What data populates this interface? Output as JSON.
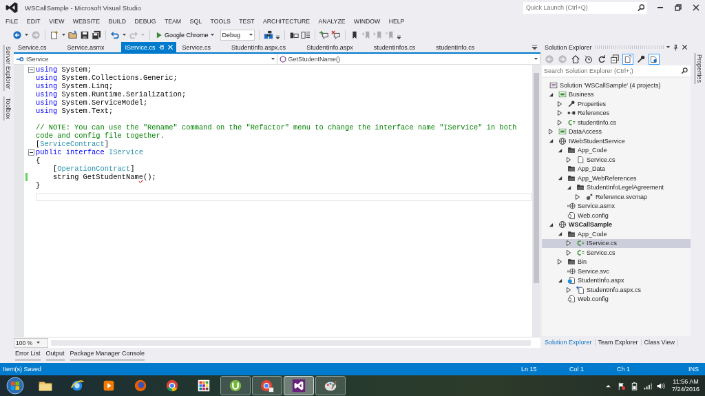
{
  "window": {
    "title": "WSCallSample - Microsoft Visual Studio",
    "quick_launch": {
      "placeholder": "Quick Launch (Ctrl+Q)"
    }
  },
  "menu": [
    "FILE",
    "EDIT",
    "VIEW",
    "WEBSITE",
    "BUILD",
    "DEBUG",
    "TEAM",
    "SQL",
    "TOOLS",
    "TEST",
    "ARCHITECTURE",
    "ANALYZE",
    "WINDOW",
    "HELP"
  ],
  "toolbar": [
    {
      "kind": "back",
      "disabled": false
    },
    {
      "kind": "caret",
      "disabled": false
    },
    {
      "kind": "forward",
      "disabled": true
    },
    {
      "kind": "separator"
    },
    {
      "kind": "new",
      "disabled": false
    },
    {
      "kind": "caret",
      "disabled": false
    },
    {
      "kind": "open",
      "disabled": false
    },
    {
      "kind": "save",
      "disabled": false
    },
    {
      "kind": "saveall",
      "disabled": false
    },
    {
      "kind": "separator"
    },
    {
      "kind": "undo",
      "disabled": false
    },
    {
      "kind": "caret",
      "disabled": false
    },
    {
      "kind": "redo",
      "disabled": true
    },
    {
      "kind": "caret",
      "disabled": true
    },
    {
      "kind": "separator"
    },
    {
      "kind": "run",
      "label": "Google Chrome"
    },
    {
      "kind": "dropdown",
      "value": "Debug"
    },
    {
      "kind": "separator"
    },
    {
      "kind": "find",
      "disabled": false
    },
    {
      "kind": "overflow"
    },
    {
      "kind": "separator"
    },
    {
      "kind": "outdent",
      "disabled": false
    },
    {
      "kind": "indent",
      "disabled": false
    },
    {
      "kind": "separator"
    },
    {
      "kind": "comment",
      "disabled": false
    },
    {
      "kind": "uncomment",
      "disabled": false
    },
    {
      "kind": "separator"
    },
    {
      "kind": "bookmark",
      "disabled": false
    },
    {
      "kind": "bmprev",
      "disabled": true
    },
    {
      "kind": "bmnext",
      "disabled": true
    },
    {
      "kind": "bmclear",
      "disabled": true
    },
    {
      "kind": "overflow"
    }
  ],
  "left_side_tabs": [
    "Server Explorer",
    "Toolbox"
  ],
  "editor": {
    "tabs": [
      {
        "label": "Service.cs",
        "selected": false
      },
      {
        "label": "Service.asmx",
        "selected": false
      },
      {
        "label": "IService.cs",
        "selected": true
      },
      {
        "label": "Service.cs",
        "selected": false
      },
      {
        "label": "StudentInfo.aspx.cs",
        "selected": false
      },
      {
        "label": "StudentInfo.aspx",
        "selected": false
      },
      {
        "label": "studentInfos.cs",
        "selected": false
      },
      {
        "label": "studentInfo.cs",
        "selected": false
      }
    ],
    "type_dropdown": "IService",
    "member_dropdown": "GetStudentName()",
    "lines": [
      {
        "tokens": [
          {
            "kind": "keyword",
            "text": "using"
          },
          {
            "kind": "plain",
            "text": " System;"
          }
        ],
        "fold": true,
        "changed": false,
        "current": false
      },
      {
        "tokens": [
          {
            "kind": "keyword",
            "text": "using"
          },
          {
            "kind": "plain",
            "text": " System.Collections.Generic;"
          }
        ],
        "fold": false,
        "changed": false,
        "current": false
      },
      {
        "tokens": [
          {
            "kind": "keyword",
            "text": "using"
          },
          {
            "kind": "plain",
            "text": " System.Linq;"
          }
        ],
        "fold": false,
        "changed": false,
        "current": false
      },
      {
        "tokens": [
          {
            "kind": "keyword",
            "text": "using"
          },
          {
            "kind": "plain",
            "text": " System.Runtime.Serialization;"
          }
        ],
        "fold": false,
        "changed": false,
        "current": false
      },
      {
        "tokens": [
          {
            "kind": "keyword",
            "text": "using"
          },
          {
            "kind": "plain",
            "text": " System.ServiceModel;"
          }
        ],
        "fold": false,
        "changed": false,
        "current": false
      },
      {
        "tokens": [
          {
            "kind": "keyword",
            "text": "using"
          },
          {
            "kind": "plain",
            "text": " System.Text;"
          }
        ],
        "fold": false,
        "changed": false,
        "current": false
      },
      {
        "fold": false,
        "changed": false,
        "current": false
      },
      {
        "tokens": [
          {
            "kind": "comment",
            "text": "// NOTE: You can use the \"Rename\" command on the \"Refactor\" menu to change the interface name \"IService\" in both code and config file together."
          }
        ],
        "fold": false,
        "changed": false,
        "current": false
      },
      {
        "tokens": [
          {
            "kind": "plain",
            "text": "["
          },
          {
            "kind": "type",
            "text": "ServiceContract"
          },
          {
            "kind": "plain",
            "text": "]"
          }
        ],
        "fold": false,
        "changed": false,
        "current": false
      },
      {
        "tokens": [
          {
            "kind": "keyword",
            "text": "public interface"
          },
          {
            "kind": "type",
            "text": " IService"
          }
        ],
        "fold": true,
        "changed": false,
        "current": false
      },
      {
        "tokens": [
          {
            "kind": "plain",
            "text": "{"
          }
        ],
        "fold": false,
        "changed": false,
        "current": false
      },
      {
        "tokens": [
          {
            "kind": "plain",
            "text": "    ["
          },
          {
            "kind": "type",
            "text": "OperationContract"
          },
          {
            "kind": "plain",
            "text": "]"
          }
        ],
        "fold": false,
        "changed": false,
        "current": false
      },
      {
        "tokens": [
          {
            "kind": "plain",
            "text": "    string GetStudentNam"
          },
          {
            "kind": "error",
            "text": "e"
          },
          {
            "kind": "plain",
            "text": "();"
          }
        ],
        "fold": false,
        "changed": true,
        "current": false
      },
      {
        "tokens": [
          {
            "kind": "plain",
            "text": "}"
          }
        ],
        "fold": false,
        "changed": false,
        "current": false
      },
      {
        "fold": false,
        "changed": false,
        "current": true
      }
    ],
    "zoom": "100 %"
  },
  "solution_explorer": {
    "title": "Solution Explorer",
    "toolbar": [
      {
        "kind": "back",
        "disabled": true,
        "pressed": false
      },
      {
        "kind": "forward",
        "disabled": true,
        "pressed": false
      },
      {
        "kind": "home",
        "disabled": false,
        "pressed": false
      },
      {
        "kind": "history",
        "disabled": false,
        "pressed": false
      },
      {
        "kind": "refresh",
        "disabled": false,
        "pressed": false
      },
      {
        "kind": "collapse",
        "disabled": false,
        "pressed": false
      },
      {
        "kind": "showall",
        "disabled": false,
        "pressed": true
      },
      {
        "kind": "properties",
        "disabled": false,
        "pressed": false
      },
      {
        "kind": "preview",
        "disabled": false,
        "pressed": true
      }
    ],
    "search": {
      "placeholder": "Search Solution Explorer (Ctrl+;)"
    },
    "tree": [
      {
        "label": "Solution 'WSCallSample' (4 projects)",
        "kind": "solution",
        "bold": false,
        "selected": false,
        "children": [
          {
            "label": "Business",
            "kind": "project",
            "bold": false,
            "selected": false,
            "expanded": true,
            "children": [
              {
                "label": "Properties",
                "kind": "wrench",
                "bold": false,
                "selected": false,
                "expanded": false
              },
              {
                "label": "References",
                "kind": "references",
                "bold": false,
                "selected": false,
                "expanded": false
              },
              {
                "label": "studentInfo.cs",
                "kind": "csfile",
                "bold": false,
                "selected": false,
                "expanded": false
              }
            ]
          },
          {
            "label": "DataAccess",
            "kind": "project",
            "bold": false,
            "selected": false,
            "expanded": false
          },
          {
            "label": "IWebStudentService",
            "kind": "globe",
            "bold": false,
            "selected": false,
            "expanded": true,
            "children": [
              {
                "label": "App_Code",
                "kind": "folder",
                "bold": false,
                "selected": false,
                "expanded": true,
                "children": [
                  {
                    "label": "Service.cs",
                    "kind": "document",
                    "bold": false,
                    "selected": false,
                    "expanded": false
                  }
                ]
              },
              {
                "label": "App_Data",
                "kind": "folder",
                "bold": false,
                "selected": false
              },
              {
                "label": "App_WebReferences",
                "kind": "folder",
                "bold": false,
                "selected": false,
                "expanded": true,
                "children": [
                  {
                    "label": "StudentInfoLegelAgreement",
                    "kind": "folder",
                    "bold": false,
                    "selected": false,
                    "expanded": true,
                    "children": [
                      {
                        "label": "Reference.svcmap",
                        "kind": "svcmap",
                        "bold": false,
                        "selected": false,
                        "expanded": false
                      }
                    ]
                  }
                ]
              },
              {
                "label": "Service.asmx",
                "kind": "webservice",
                "bold": false,
                "selected": false
              },
              {
                "label": "Web.config",
                "kind": "config",
                "bold": false,
                "selected": false
              }
            ]
          },
          {
            "label": "WSCallSample",
            "kind": "globe",
            "bold": true,
            "selected": false,
            "expanded": true,
            "children": [
              {
                "label": "App_Code",
                "kind": "folder",
                "bold": false,
                "selected": false,
                "expanded": true,
                "children": [
                  {
                    "label": "IService.cs",
                    "kind": "csfile",
                    "bold": false,
                    "selected": true,
                    "expanded": false
                  },
                  {
                    "label": "Service.cs",
                    "kind": "csfile",
                    "bold": false,
                    "selected": false,
                    "expanded": false
                  }
                ]
              },
              {
                "label": "Bin",
                "kind": "folder",
                "bold": false,
                "selected": false,
                "expanded": false
              },
              {
                "label": "Service.svc",
                "kind": "webservice",
                "bold": false,
                "selected": false
              },
              {
                "label": "StudentInfo.aspx",
                "kind": "aspx",
                "bold": false,
                "selected": false,
                "expanded": true,
                "children": [
                  {
                    "label": "StudentInfo.aspx.cs",
                    "kind": "codebehind",
                    "bold": false,
                    "selected": false,
                    "expanded": false
                  }
                ]
              },
              {
                "label": "Web.config",
                "kind": "config",
                "bold": false,
                "selected": false
              }
            ]
          }
        ]
      }
    ],
    "bottom_tabs": [
      {
        "label": "Solution Explorer",
        "selected": true
      },
      {
        "label": "Team Explorer",
        "selected": false
      },
      {
        "label": "Class View",
        "selected": false
      }
    ]
  },
  "right_side_tabs": [
    "Properties"
  ],
  "tool_tabs": [
    "Error List",
    "Output",
    "Package Manager Console"
  ],
  "status_bar": {
    "message": "Item(s) Saved",
    "line": "Ln 15",
    "column": "Col 1",
    "char": "Ch 1",
    "mode": "INS"
  },
  "taskbar": {
    "items": [
      {
        "kind": "folder",
        "open": false,
        "focused": false
      },
      {
        "kind": "ie",
        "open": false,
        "focused": false
      },
      {
        "kind": "media",
        "open": false,
        "focused": false
      },
      {
        "kind": "firefox",
        "open": false,
        "focused": false
      },
      {
        "kind": "chrome",
        "open": false,
        "focused": false
      },
      {
        "kind": "tiles",
        "open": false,
        "focused": false
      },
      {
        "kind": "torrent",
        "open": true,
        "focused": false
      },
      {
        "kind": "chromeuser",
        "open": true,
        "focused": false
      },
      {
        "kind": "ide",
        "open": true,
        "focused": true
      },
      {
        "kind": "paint",
        "open": true,
        "focused": false
      }
    ],
    "time": "11:56 AM",
    "date": "7/24/2016"
  }
}
